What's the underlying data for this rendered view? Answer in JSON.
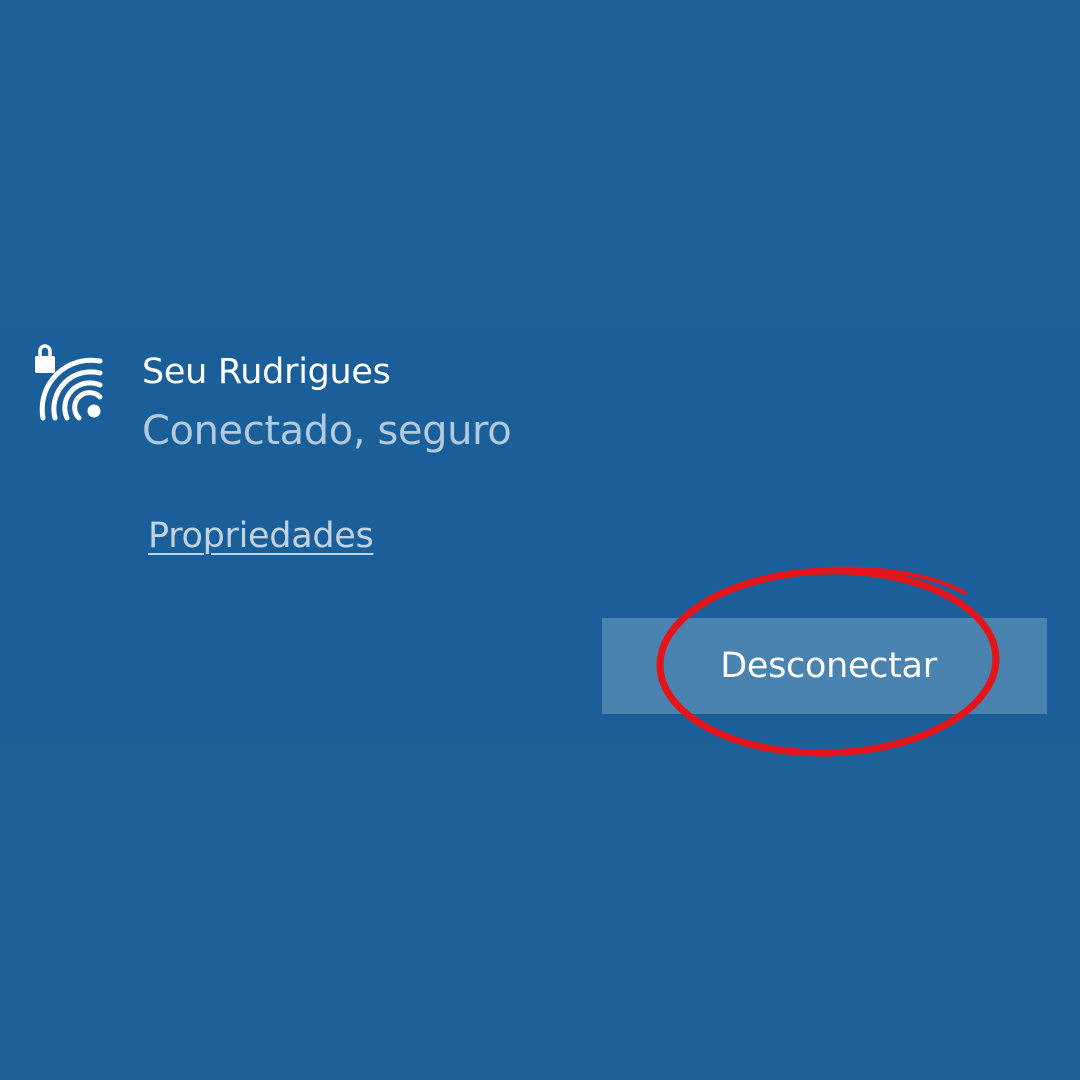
{
  "network": {
    "name": "Seu Rudrigues",
    "status": "Conectado, seguro",
    "icon": "wifi-secured-icon"
  },
  "actions": {
    "properties_label": "Propriedades",
    "disconnect_label": "Desconectar"
  },
  "annotation": {
    "shape": "ellipse",
    "color": "#e3151b",
    "target": "disconnect-button"
  },
  "colors": {
    "background": "#1c6096",
    "button": "#4a83b0",
    "text_primary": "#ffffff",
    "text_secondary": "#b3c9dd"
  }
}
